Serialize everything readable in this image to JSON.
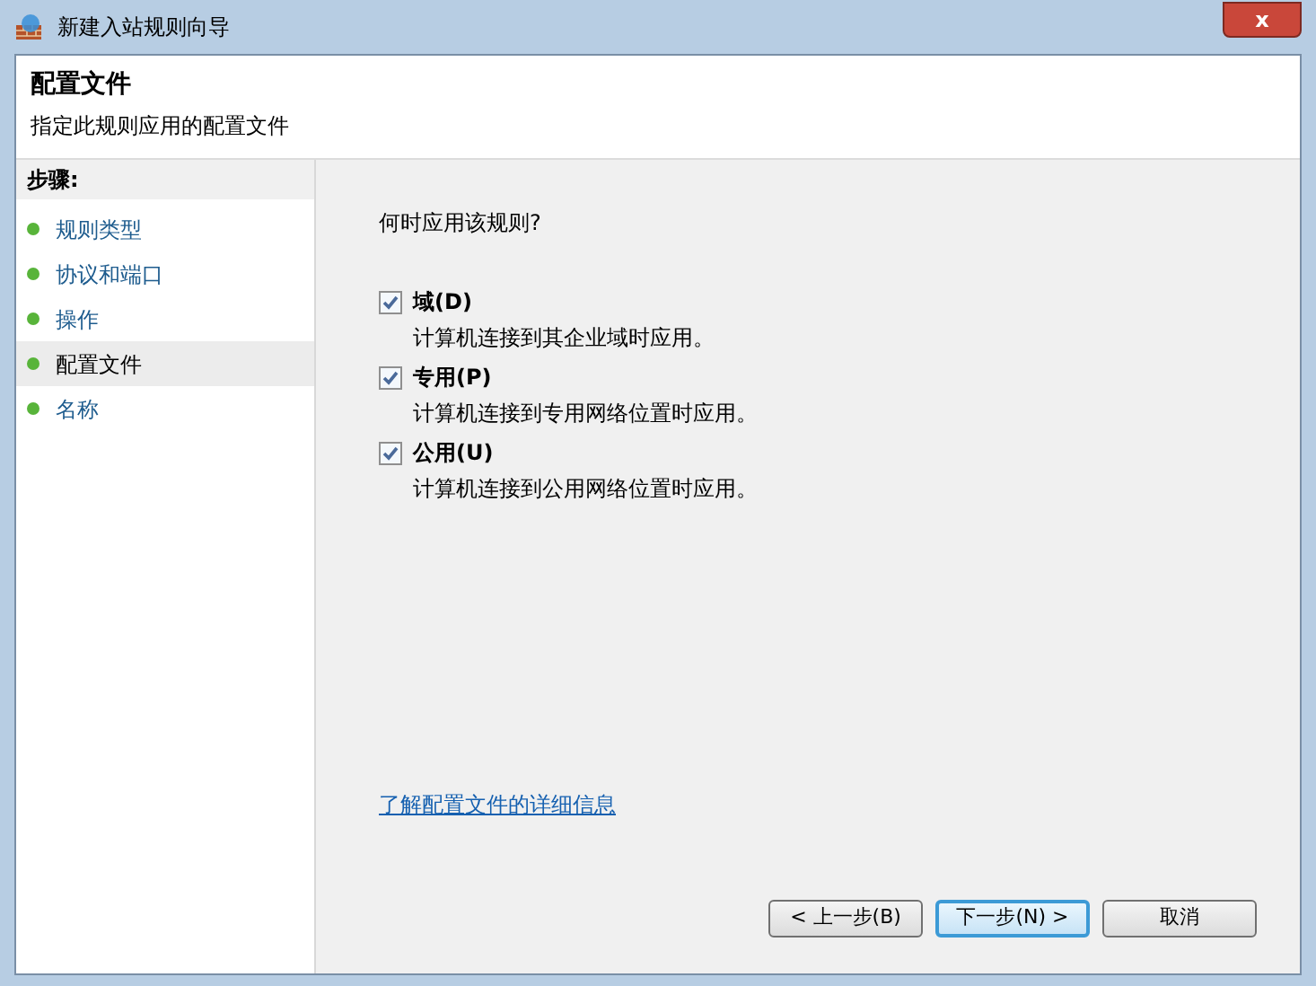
{
  "window": {
    "title": "新建入站规则向导",
    "close": "x"
  },
  "header": {
    "title": "配置文件",
    "subtitle": "指定此规则应用的配置文件"
  },
  "steps": {
    "heading": "步骤:",
    "items": [
      {
        "label": "规则类型",
        "selected": false
      },
      {
        "label": "协议和端口",
        "selected": false
      },
      {
        "label": "操作",
        "selected": false
      },
      {
        "label": "配置文件",
        "selected": true
      },
      {
        "label": "名称",
        "selected": false
      }
    ]
  },
  "question": "何时应用该规则?",
  "options": [
    {
      "label": "域(D)",
      "description": "计算机连接到其企业域时应用。",
      "checked": true
    },
    {
      "label": "专用(P)",
      "description": "计算机连接到专用网络位置时应用。",
      "checked": true
    },
    {
      "label": "公用(U)",
      "description": "计算机连接到公用网络位置时应用。",
      "checked": true
    }
  ],
  "link": "了解配置文件的详细信息",
  "buttons": [
    {
      "label": "< 上一步(B)",
      "default": false
    },
    {
      "label": "下一步(N) >",
      "default": true
    },
    {
      "label": "取消",
      "default": false
    }
  ]
}
